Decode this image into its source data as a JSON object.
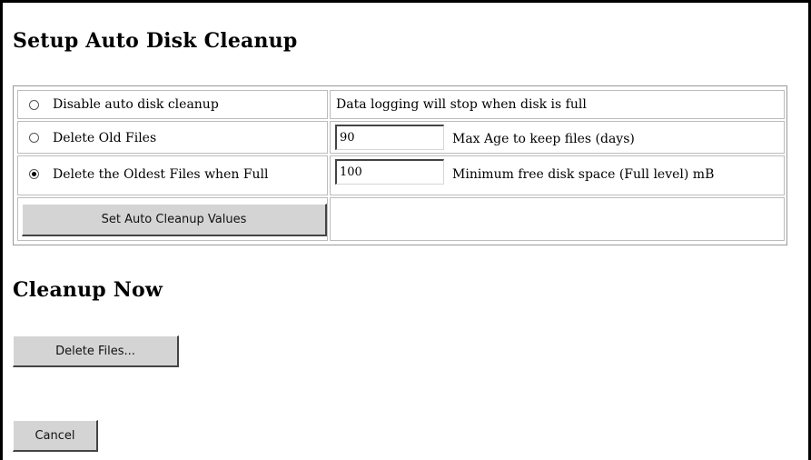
{
  "setup": {
    "title": "Setup Auto Disk Cleanup",
    "options": [
      {
        "label": "Disable auto disk cleanup",
        "selected": false,
        "note": "Data logging will stop when disk is full"
      },
      {
        "label": "Delete Old Files",
        "selected": false,
        "value": "90",
        "note": "Max Age to keep files (days)"
      },
      {
        "label": "Delete the Oldest Files when Full",
        "selected": true,
        "value": "100",
        "note": "Minimum free disk space (Full level) mB"
      }
    ],
    "set_button": "Set Auto Cleanup Values"
  },
  "cleanup": {
    "title": "Cleanup Now",
    "delete_button": "Delete Files..."
  },
  "cancel_button": "Cancel"
}
